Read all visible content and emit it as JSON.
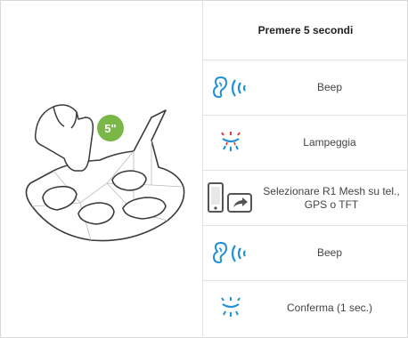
{
  "header": {
    "title": "Premere 5 secondi"
  },
  "illustration": {
    "press_badge": "5\"",
    "badge_color": "#7ab648"
  },
  "steps": [
    {
      "icon": "ear-sound-icon",
      "label": "Beep"
    },
    {
      "icon": "led-flash-red-blue-icon",
      "label": "Lampeggia"
    },
    {
      "icon": "phone-screen-icon",
      "label": "Selezionare R1 Mesh su tel., GPS o TFT"
    },
    {
      "icon": "ear-sound-icon",
      "label": "Beep"
    },
    {
      "icon": "led-flash-blue-icon",
      "label": "Conferma (1 sec.)"
    }
  ],
  "colors": {
    "accent_blue": "#1e90d8",
    "led_red": "#e03a3a",
    "badge_green": "#7ab648"
  }
}
